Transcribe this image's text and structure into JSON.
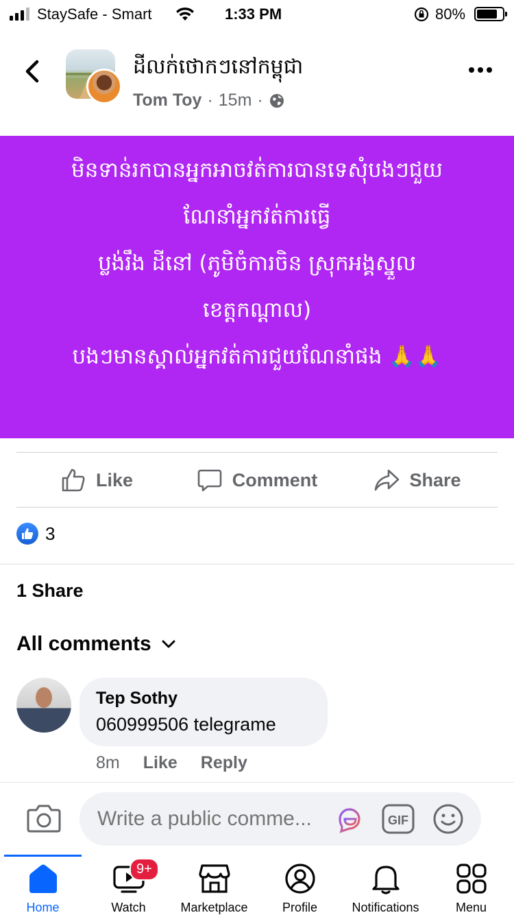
{
  "status_bar": {
    "carrier": "StaySafe - Smart",
    "time": "1:33 PM",
    "battery_percent": "80%",
    "battery_level": 0.8,
    "signal_bars": 3
  },
  "header": {
    "group_name": "ដីលក់ថោកៗនៅកម្ពុជា",
    "author": "Tom Toy",
    "time_ago": "15m",
    "separator": "·"
  },
  "post": {
    "background_color": "#b026f2",
    "lines": [
      "មិនទាន់រកបានអ្នកអាចវត់ការបានទេសុំបងៗជួយ",
      "ណែនាំអ្នកវត់ការធ្វើ",
      "ប្លង់រឹង ដីនៅ (ភូមិចំការចិន ស្រុកអង្គស្នួល",
      "ខេត្តកណ្ដាល)",
      "បងៗមានស្គាល់អ្នកវត់ការជួយណែនាំផង 🙏🙏"
    ]
  },
  "actions": {
    "like": "Like",
    "comment": "Comment",
    "share": "Share"
  },
  "reactions": {
    "count": "3"
  },
  "shares_label": "1 Share",
  "comments_filter": "All comments",
  "comments": [
    {
      "name": "Tep Sothy",
      "text": "060999506 telegrame",
      "time": "8m",
      "like": "Like",
      "reply": "Reply"
    }
  ],
  "composer": {
    "placeholder": "Write a public comme..."
  },
  "tabs": {
    "home": "Home",
    "watch": "Watch",
    "watch_badge": "9+",
    "marketplace": "Marketplace",
    "profile": "Profile",
    "notifications": "Notifications",
    "menu": "Menu"
  },
  "colors": {
    "accent": "#0866ff",
    "badge": "#e41e3f",
    "post_bg": "#b026f2"
  }
}
